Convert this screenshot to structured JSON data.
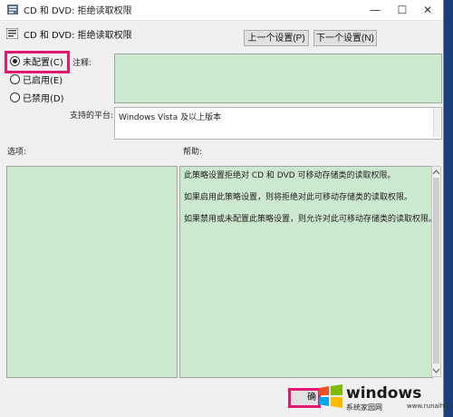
{
  "window": {
    "title": "CD 和 DVD: 拒绝读取权限",
    "min": "—",
    "max": "☐",
    "close": "✕"
  },
  "policy_name": "CD 和 DVD: 拒绝读取权限",
  "buttons": {
    "prev": "上一个设置(P)",
    "next": "下一个设置(N)",
    "ok": "确定"
  },
  "radios": [
    {
      "label": "未配置(C)",
      "checked": true
    },
    {
      "label": "已启用(E)",
      "checked": false
    },
    {
      "label": "已禁用(D)",
      "checked": false
    }
  ],
  "labels": {
    "comment": "注释:",
    "platform": "支持的平台:",
    "options": "选项:",
    "help": "帮助:"
  },
  "platform_text": "Windows Vista 及以上版本",
  "help_lines": [
    "此策略设置拒绝对 CD 和 DVD 可移动存储类的读取权限。",
    "如果启用此策略设置，则将拒绝对此可移动存储类的读取权限。",
    "如果禁用或未配置此策略设置，则允许对此可移动存储类的读取权限。"
  ],
  "watermark": {
    "brand": "windows",
    "sub": "系统家园网",
    "url": "www.runaihe.com"
  },
  "colors": {
    "highlight": "#e0186f",
    "comment_bg": "#cce8cf"
  }
}
